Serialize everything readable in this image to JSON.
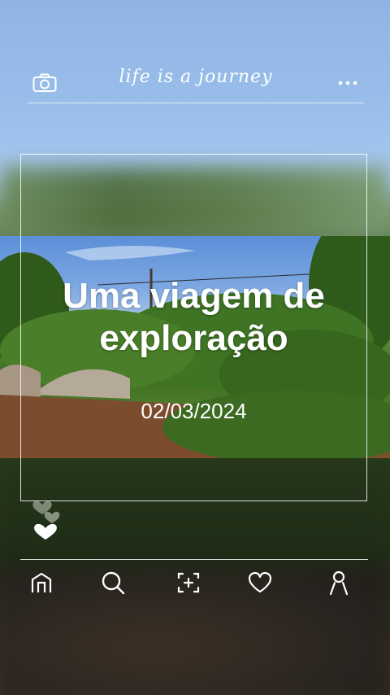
{
  "header": {
    "logo_text": "life is a journey",
    "camera_icon": "camera-icon",
    "more_icon": "more-dots-icon"
  },
  "post": {
    "title": "Uma viagem de exploração",
    "date": "02/03/2024"
  },
  "reactions": {
    "icon": "hearts-icon"
  },
  "nav": {
    "items": [
      {
        "icon": "home-icon"
      },
      {
        "icon": "search-icon"
      },
      {
        "icon": "add-post-icon"
      },
      {
        "icon": "heart-icon"
      },
      {
        "icon": "profile-icon"
      }
    ]
  },
  "colors": {
    "accent": "#ffffff",
    "sky": "#9cc0ec"
  }
}
